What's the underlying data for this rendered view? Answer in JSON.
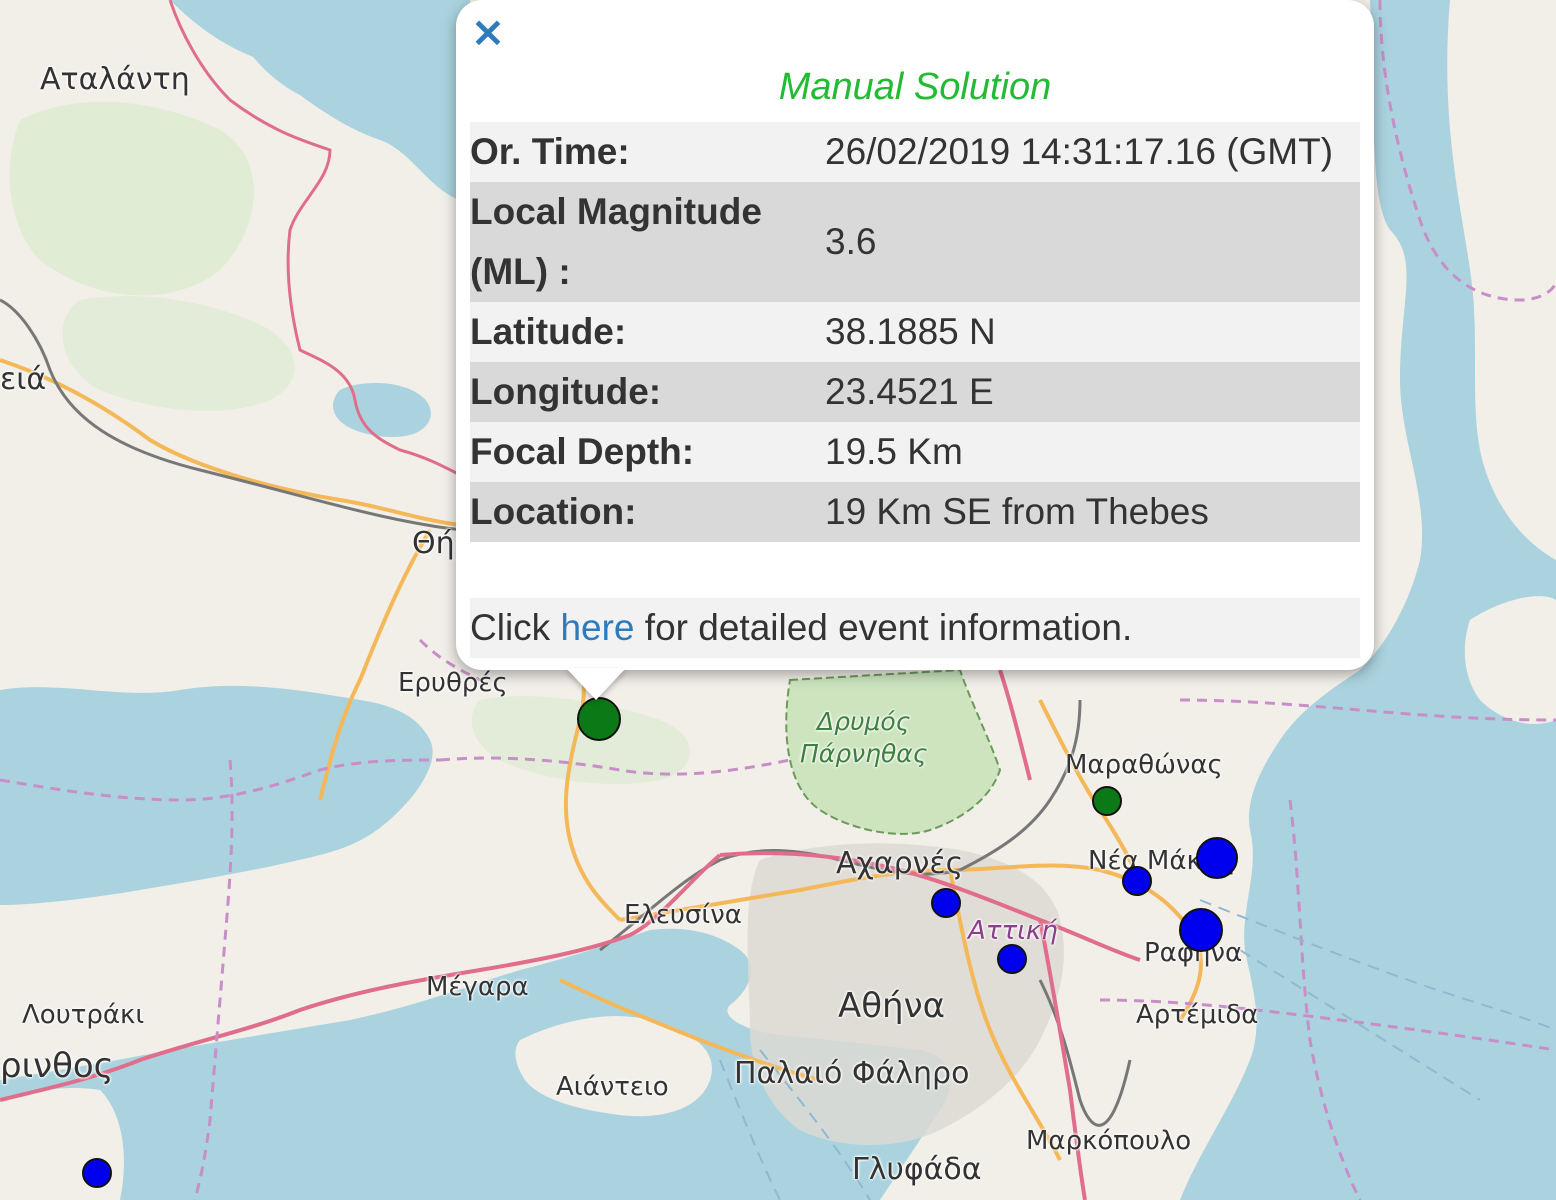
{
  "map": {
    "places": {
      "atalanti": "Αταλάντη",
      "thiva_partial": "Θή",
      "livadeia_partial": "ειά",
      "erythres": "Ερυθρές",
      "park_line1": "Δρυμός",
      "park_line2": "Πάρνηθας",
      "marathonas": "Μαραθώνας",
      "acharnes": "Αχαρνές",
      "nea_makri_partial": "Νέα Μάκρη",
      "elefsina": "Ελευσίνα",
      "attiki": "Αττική",
      "rafina": "Ραφήνα",
      "megara": "Μέγαρα",
      "athina": "Αθήνα",
      "artemida": "Αρτέμιδα",
      "loutraki": "Λουτράκι",
      "korinthos_partial": "ρινθος",
      "aianteio": "Αιάντειο",
      "palaio_faliro": "Παλαιό Φάληρο",
      "markopoulo": "Μαρκόπουλο",
      "glyfada": "Γλυφάδα"
    },
    "colors": {
      "land": "#f2efe9",
      "water": "#aad3df",
      "green_area": "#dcebd0",
      "border": "#e06e8a",
      "road": "#f4b859",
      "rail": "#777777",
      "admin_boundary": "#c88ec8",
      "marker_manual": "#0b7a16",
      "marker_auto": "#0000ee"
    }
  },
  "popup": {
    "close_icon": "×",
    "title": "Manual Solution",
    "rows": [
      {
        "label": "Or. Time:",
        "value": "26/02/2019 14:31:17.16 (GMT)"
      },
      {
        "label": "Local Magnitude (ML) :",
        "value": "3.6"
      },
      {
        "label": "Latitude:",
        "value": "38.1885 N"
      },
      {
        "label": "Longitude:",
        "value": "23.4521 E"
      },
      {
        "label": "Focal Depth:",
        "value": "19.5 Km"
      },
      {
        "label": "Location:",
        "value": "19 Km SE from Thebes"
      }
    ],
    "footer": {
      "before": "Click",
      "link": "here",
      "after": "for detailed event information."
    }
  }
}
